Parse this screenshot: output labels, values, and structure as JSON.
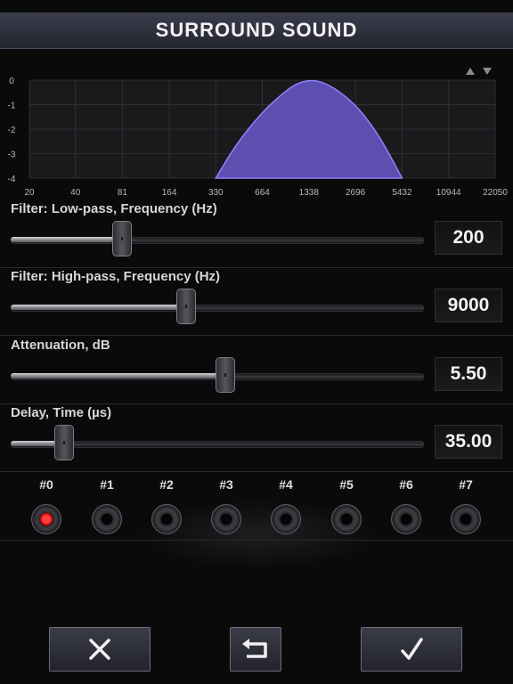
{
  "header": {
    "title": "SURROUND SOUND"
  },
  "chart": {
    "y_ticks": [
      "0",
      "-1",
      "-2",
      "-3",
      "-4"
    ],
    "x_ticks": [
      "20",
      "40",
      "81",
      "164",
      "330",
      "664",
      "1338",
      "2696",
      "5432",
      "10944",
      "22050"
    ],
    "fill_color": "#5c4fb0",
    "line_color": "#8f82ff",
    "controls": {
      "up_icon": "triangle-up-icon",
      "down_icon": "triangle-down-icon"
    }
  },
  "chart_data": {
    "type": "area",
    "x_scale": "log",
    "x": [
      330,
      450,
      664,
      900,
      1100,
      1338,
      1600,
      2000,
      2696,
      3500,
      4300,
      5432
    ],
    "y": [
      -4.0,
      -2.6,
      -1.3,
      -0.55,
      -0.15,
      0.0,
      -0.05,
      -0.35,
      -1.0,
      -1.9,
      -2.8,
      -4.0
    ],
    "xlim": [
      20,
      22050
    ],
    "ylim": [
      -4,
      0
    ],
    "xticks": [
      "20",
      "40",
      "81",
      "164",
      "330",
      "664",
      "1338",
      "2696",
      "5432",
      "10944",
      "22050"
    ],
    "yticks": [
      "0",
      "-1",
      "-2",
      "-3",
      "-4"
    ],
    "grid": true
  },
  "filters": [
    {
      "label": "Filter: Low-pass, Frequency (Hz)",
      "value": "200",
      "level": 0.27
    },
    {
      "label": "Filter: High-pass, Frequency (Hz)",
      "value": "9000",
      "level": 0.425
    },
    {
      "label": "Attenuation, dB",
      "value": "5.50",
      "level": 0.52
    },
    {
      "label": "Delay, Time (µs)",
      "value": "35.00",
      "level": 0.13
    }
  ],
  "channels": {
    "active_index": 0,
    "active_color": "#e81010",
    "items": [
      "#0",
      "#1",
      "#2",
      "#3",
      "#4",
      "#5",
      "#6",
      "#7"
    ]
  },
  "buttons": {
    "cancel_icon": "close-icon",
    "undo_icon": "undo-icon",
    "confirm_icon": "checkmark-icon"
  }
}
